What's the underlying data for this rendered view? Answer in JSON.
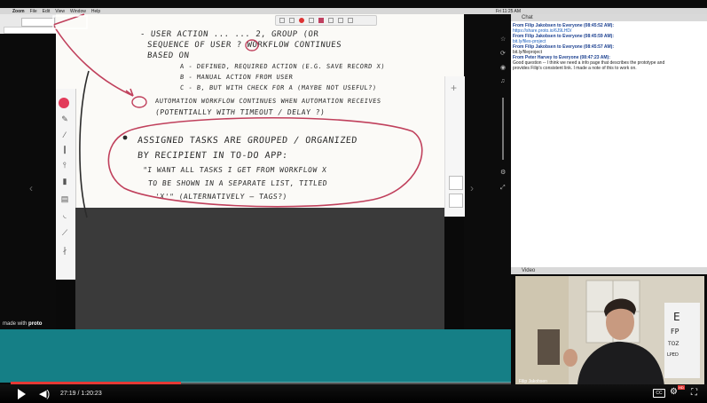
{
  "menubar": {
    "app": "Zoom",
    "items": [
      "File",
      "Edit",
      "View",
      "Window",
      "Help"
    ],
    "clock": "Fri 11:25 AM"
  },
  "notes": {
    "lines": [
      "- USER ACTION ... ... 2, GROUP (OR",
      "SEQUENCE OF USER  ?  WORKFLOW CONTINUES",
      "BASED ON",
      "A - DEFINED, REQUIRED ACTION (E.G. SAVE RECORD X)",
      "B - MANUAL ACTION FROM USER",
      "C - B, BUT WITH CHECK FOR A (MAYBE NOT USEFUL?)",
      "AUTOMATION WORKFLOW CONTINUES WHEN AUTOMATION RECEIVES",
      "(POTENTIALLY WITH TIMEOUT / DELAY ?)",
      "ASSIGNED TASKS ARE GROUPED / ORGANIZED",
      "BY RECIPIENT IN TO-DO APP:",
      "\"I WANT ALL TASKS I GET FROM WORKFLOW X",
      "TO BE SHOWN IN A SEPARATE LIST, TITLED",
      "'X'\" (ALTERNATIVELY — TAGS?)"
    ]
  },
  "made_with": {
    "prefix": "made with",
    "brand": "proto"
  },
  "player": {
    "time": "27:19 / 1:20:23",
    "progress_fraction": 0.34,
    "cc": "CC",
    "hd": "HD"
  },
  "chat": {
    "title": "Chat",
    "messages": [
      {
        "from": "From Filip Jakobsen to Everyone (08:45:52 AM):",
        "lines": [
          "https://share.proto.io/6J9LHD/"
        ],
        "link": true
      },
      {
        "from": "From Filip Jakobsen to Everyone (08:45:59 AM):",
        "lines": [
          "bit.ly/files-project"
        ],
        "link": true
      },
      {
        "from": "From Filip Jakobsen to Everyone (08:45:57 AM):",
        "lines": [
          "bit.ly/fileproject"
        ],
        "link": false
      },
      {
        "from": "From Peter Harvey to Everyone (08:47:23 AM):",
        "lines": [
          "Good question -- I think we need a info page that describes the prototype and",
          "provides Filip's consistent link. I made a note of this to work on."
        ],
        "link": false
      }
    ]
  },
  "video": {
    "title": "Video",
    "presenter": "Filip Jakobsen"
  },
  "colors": {
    "teal": "#157f86",
    "progress": "#e53935",
    "ink": "#c0405c"
  }
}
